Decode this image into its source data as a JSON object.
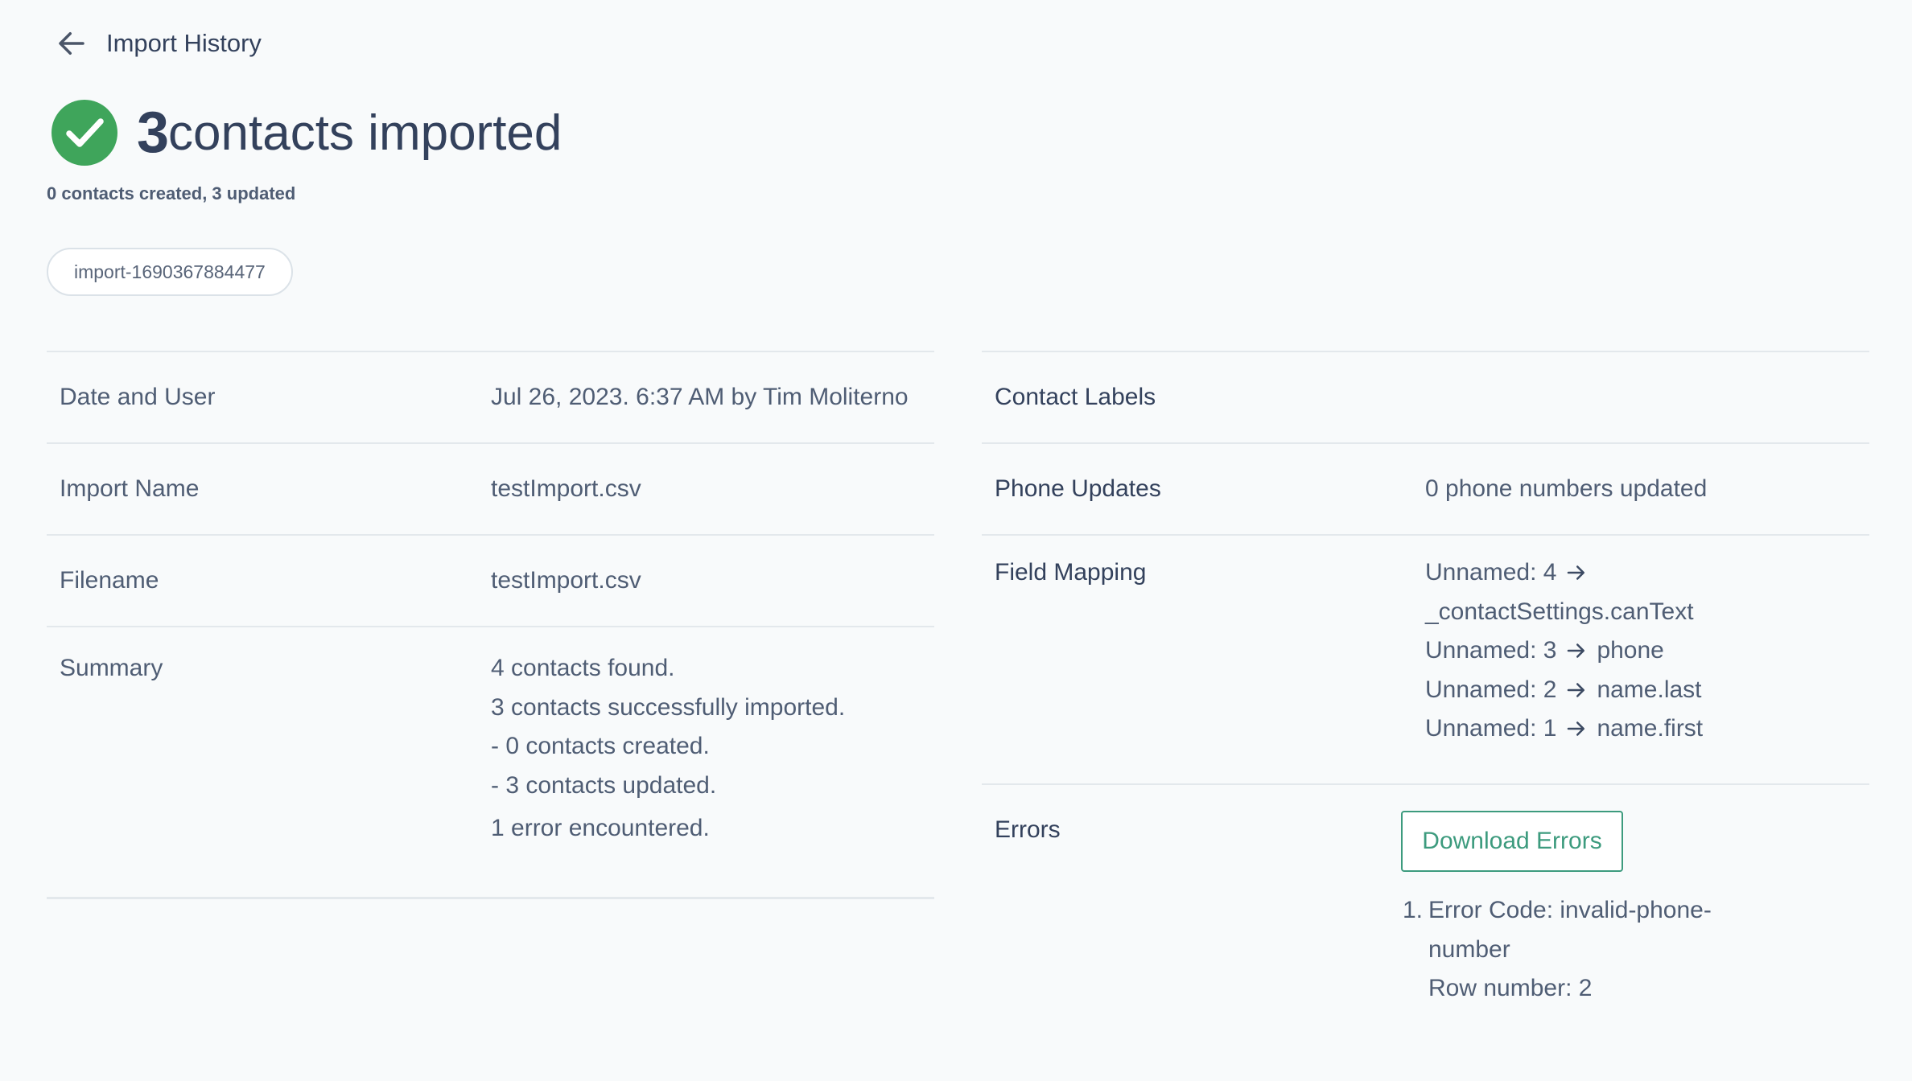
{
  "nav": {
    "back_label": "Import History"
  },
  "hero": {
    "count": "3",
    "title": "contacts imported",
    "subtitle": "0 contacts created, 3 updated"
  },
  "tag": {
    "label": "import-1690367884477"
  },
  "details": {
    "date_user": {
      "label": "Date and User",
      "value": "Jul 26, 2023. 6:37 AM by Tim Moliterno"
    },
    "import_name": {
      "label": "Import Name",
      "value": "testImport.csv"
    },
    "filename": {
      "label": "Filename",
      "value": "testImport.csv"
    },
    "summary": {
      "label": "Summary",
      "lines": [
        "4 contacts found.",
        "3 contacts successfully imported.",
        "- 0 contacts created.",
        "- 3 contacts updated."
      ],
      "errors_line": "1 error encountered."
    }
  },
  "right": {
    "contact_labels": {
      "label": "Contact Labels"
    },
    "phone_updates": {
      "label": "Phone Updates",
      "value": "0 phone numbers updated"
    },
    "field_mapping": {
      "label": "Field Mapping",
      "items": [
        {
          "from": "Unnamed: 4",
          "to": "_contactSettings.canText"
        },
        {
          "from": "Unnamed: 3",
          "to": "phone"
        },
        {
          "from": "Unnamed: 2",
          "to": "name.last"
        },
        {
          "from": "Unnamed: 1",
          "to": "name.first"
        }
      ]
    },
    "errors": {
      "label": "Errors",
      "download_label": "Download Errors",
      "items": [
        {
          "number": "1.",
          "code_line_1": "Error Code: invalid-phone-",
          "code_line_2": "number",
          "row": "Row number: 2"
        }
      ]
    }
  },
  "colors": {
    "success": "#3fa55b",
    "accent": "#3d9b7e",
    "link": "#2e8a8a",
    "text": "#33415c"
  }
}
